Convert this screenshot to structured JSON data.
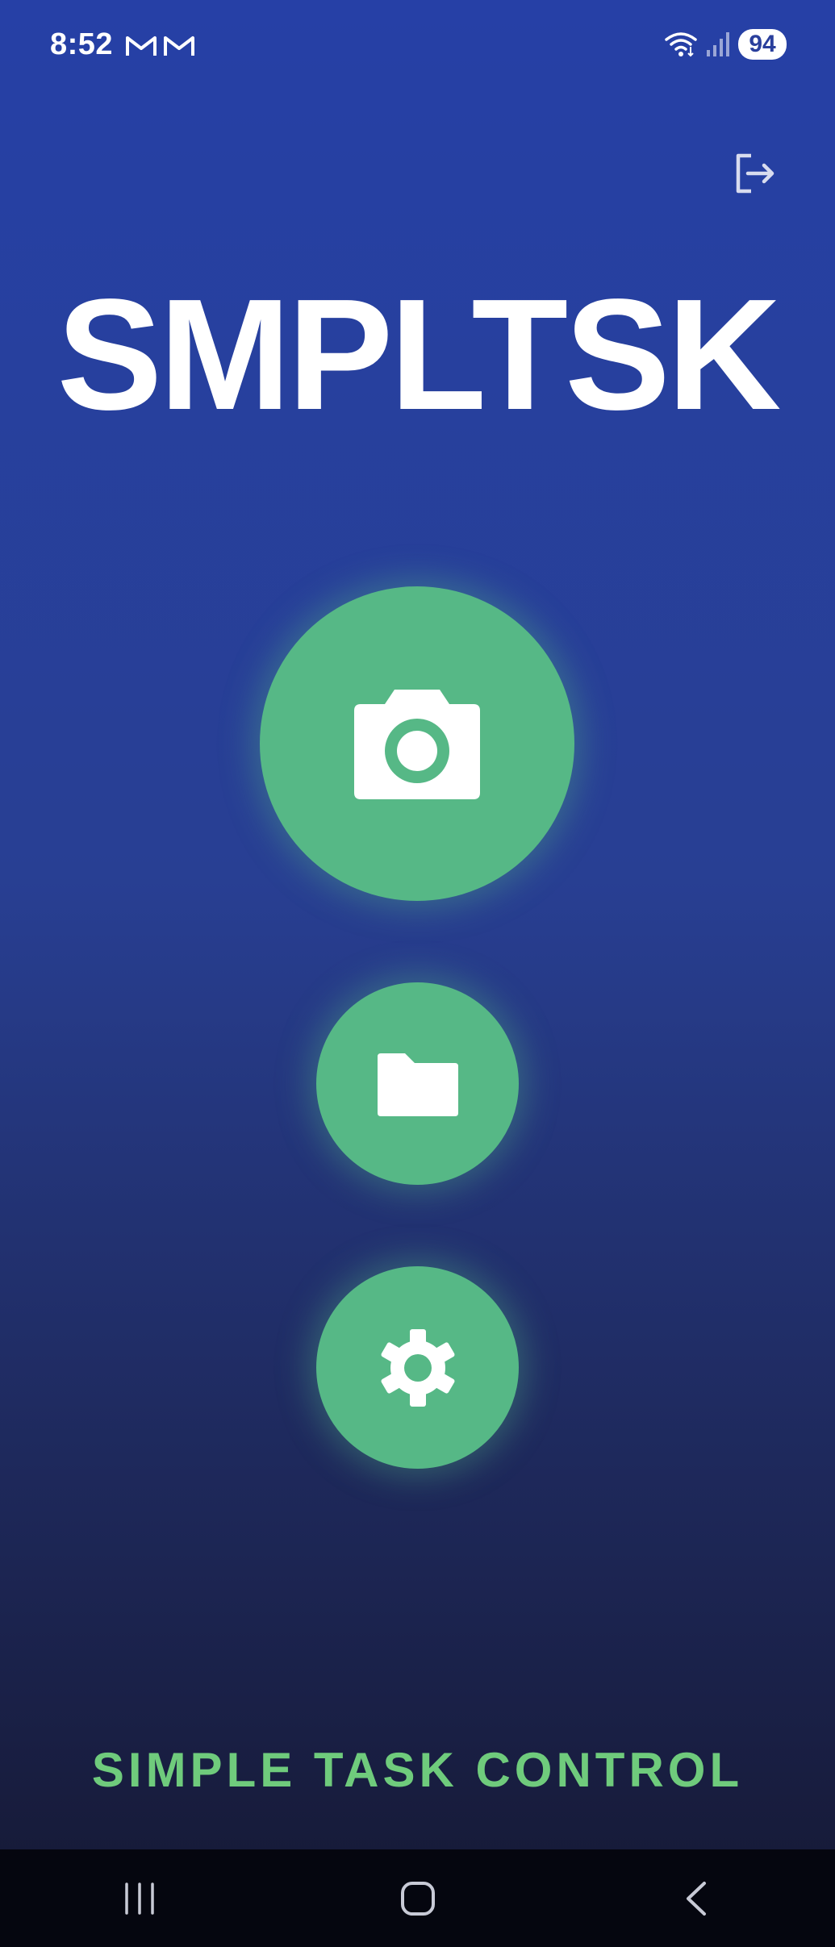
{
  "status_bar": {
    "time": "8:52",
    "notification_icons": [
      "gmail-icon",
      "gmail-icon"
    ],
    "battery": "94",
    "icons": [
      "wifi-icon",
      "signal-icon"
    ]
  },
  "header": {
    "logout_icon": "logout-icon"
  },
  "app": {
    "title": "SMPLTSK",
    "tagline": "SIMPLE TASK CONTROL"
  },
  "actions": [
    {
      "name": "camera",
      "icon": "camera-icon"
    },
    {
      "name": "files",
      "icon": "folder-icon"
    },
    {
      "name": "settings",
      "icon": "gear-icon"
    }
  ],
  "navigation": {
    "buttons": [
      "recents",
      "home",
      "back"
    ]
  },
  "colors": {
    "background_top": "#2640a6",
    "background_bottom": "#141831",
    "accent": "#56b886",
    "tagline": "#6fcb7c",
    "nav_bar": "#05060f"
  }
}
